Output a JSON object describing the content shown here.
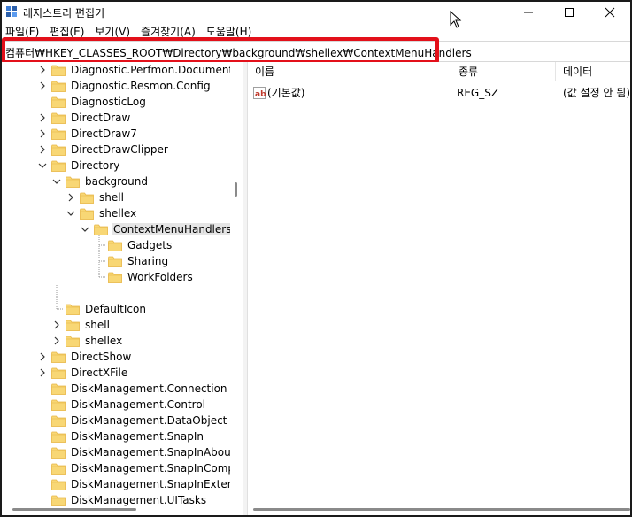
{
  "window": {
    "title": "레지스트리 편집기",
    "controls": {
      "minimize": "—",
      "maximize": "☐",
      "close": "✕"
    }
  },
  "menu": [
    "파일(F)",
    "편집(E)",
    "보기(V)",
    "즐겨찾기(A)",
    "도움말(H)"
  ],
  "address": "컴퓨터₩HKEY_CLASSES_ROOT₩Directory₩background₩shellex₩ContextMenuHandlers",
  "tree": [
    {
      "label": "Diagnostic.Perfmon.Document",
      "expander": "collapsed"
    },
    {
      "label": "Diagnostic.Resmon.Config",
      "expander": "collapsed"
    },
    {
      "label": "DiagnosticLog",
      "expander": "none"
    },
    {
      "label": "DirectDraw",
      "expander": "collapsed"
    },
    {
      "label": "DirectDraw7",
      "expander": "collapsed"
    },
    {
      "label": "DirectDrawClipper",
      "expander": "collapsed"
    },
    {
      "label": "Directory",
      "expander": "expanded"
    },
    {
      "label": "background",
      "expander": "expanded"
    },
    {
      "label": "shell",
      "expander": "collapsed"
    },
    {
      "label": "shellex",
      "expander": "expanded"
    },
    {
      "label": "ContextMenuHandlers",
      "expander": "expanded",
      "selected": true
    },
    {
      "label": "Gadgets",
      "expander": "none"
    },
    {
      "label": "Sharing",
      "expander": "none"
    },
    {
      "label": "WorkFolders",
      "expander": "none"
    },
    {
      "label": "DefaultIcon",
      "expander": "none"
    },
    {
      "label": "shell",
      "expander": "collapsed"
    },
    {
      "label": "shellex",
      "expander": "collapsed"
    },
    {
      "label": "DirectShow",
      "expander": "collapsed"
    },
    {
      "label": "DirectXFile",
      "expander": "collapsed"
    },
    {
      "label": "DiskManagement.Connection",
      "expander": "none"
    },
    {
      "label": "DiskManagement.Control",
      "expander": "none"
    },
    {
      "label": "DiskManagement.DataObject",
      "expander": "none"
    },
    {
      "label": "DiskManagement.SnapIn",
      "expander": "none"
    },
    {
      "label": "DiskManagement.SnapInAbout",
      "expander": "none"
    },
    {
      "label": "DiskManagement.SnapInCompon",
      "expander": "none"
    },
    {
      "label": "DiskManagement.SnapInExtension",
      "expander": "none"
    },
    {
      "label": "DiskManagement.UITasks",
      "expander": "none"
    }
  ],
  "columns": {
    "name": "이름",
    "type": "종류",
    "data": "데이터"
  },
  "values": [
    {
      "icon": "ab",
      "name": "(기본값)",
      "type": "REG_SZ",
      "data": "(값 설정 안 됨)"
    }
  ],
  "colors": {
    "folder": "#f8d775",
    "folder_dark": "#e8b84a",
    "highlight": "#e3101a",
    "selection": "#e5e5e5"
  }
}
